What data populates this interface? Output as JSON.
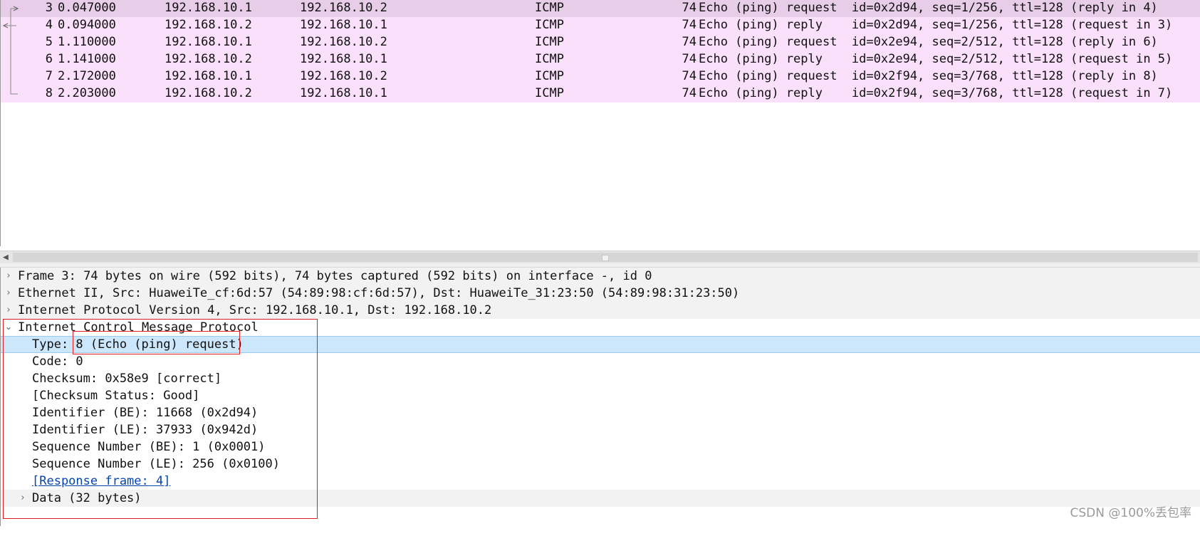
{
  "packets": [
    {
      "no": "3",
      "time": "0.047000",
      "src": "192.168.10.1",
      "dst": "192.168.10.2",
      "proto": "ICMP",
      "len": "74",
      "info": "Echo (ping) request  id=0x2d94, seq=1/256, ttl=128 (reply in 4)"
    },
    {
      "no": "4",
      "time": "0.094000",
      "src": "192.168.10.2",
      "dst": "192.168.10.1",
      "proto": "ICMP",
      "len": "74",
      "info": "Echo (ping) reply    id=0x2d94, seq=1/256, ttl=128 (request in 3)"
    },
    {
      "no": "5",
      "time": "1.110000",
      "src": "192.168.10.1",
      "dst": "192.168.10.2",
      "proto": "ICMP",
      "len": "74",
      "info": "Echo (ping) request  id=0x2e94, seq=2/512, ttl=128 (reply in 6)"
    },
    {
      "no": "6",
      "time": "1.141000",
      "src": "192.168.10.2",
      "dst": "192.168.10.1",
      "proto": "ICMP",
      "len": "74",
      "info": "Echo (ping) reply    id=0x2e94, seq=2/512, ttl=128 (request in 5)"
    },
    {
      "no": "7",
      "time": "2.172000",
      "src": "192.168.10.1",
      "dst": "192.168.10.2",
      "proto": "ICMP",
      "len": "74",
      "info": "Echo (ping) request  id=0x2f94, seq=3/768, ttl=128 (reply in 8)"
    },
    {
      "no": "8",
      "time": "2.203000",
      "src": "192.168.10.2",
      "dst": "192.168.10.1",
      "proto": "ICMP",
      "len": "74",
      "info": "Echo (ping) reply    id=0x2f94, seq=3/768, ttl=128 (request in 7)"
    }
  ],
  "details": {
    "frame": "Frame 3: 74 bytes on wire (592 bits), 74 bytes captured (592 bits) on interface -, id 0",
    "ethernet": "Ethernet II, Src: HuaweiTe_cf:6d:57 (54:89:98:cf:6d:57), Dst: HuaweiTe_31:23:50 (54:89:98:31:23:50)",
    "ipv4": "Internet Protocol Version 4, Src: 192.168.10.1, Dst: 192.168.10.2",
    "icmp": "Internet Control Message Protocol",
    "icmp_fields": {
      "type": "Type: 8 (Echo (ping) request)",
      "code": "Code: 0",
      "checksum": "Checksum: 0x58e9 [correct]",
      "checksum_status": "[Checksum Status: Good]",
      "identifier_be": "Identifier (BE): 11668 (0x2d94)",
      "identifier_le": "Identifier (LE): 37933 (0x942d)",
      "sequence_be": "Sequence Number (BE): 1 (0x0001)",
      "sequence_le": "Sequence Number (LE): 256 (0x0100)",
      "response_frame": "[Response frame: 4]",
      "data": "Data (32 bytes)"
    }
  },
  "icons": {
    "collapsed": "chevron-right-icon",
    "expanded": "chevron-down-icon"
  },
  "colors": {
    "icmp_row": "#fbe0fb",
    "selected_row": "#e7cde7",
    "highlight_field": "#cce6fb",
    "annotation": "#e02020"
  },
  "watermark": "CSDN @100%丢包率"
}
